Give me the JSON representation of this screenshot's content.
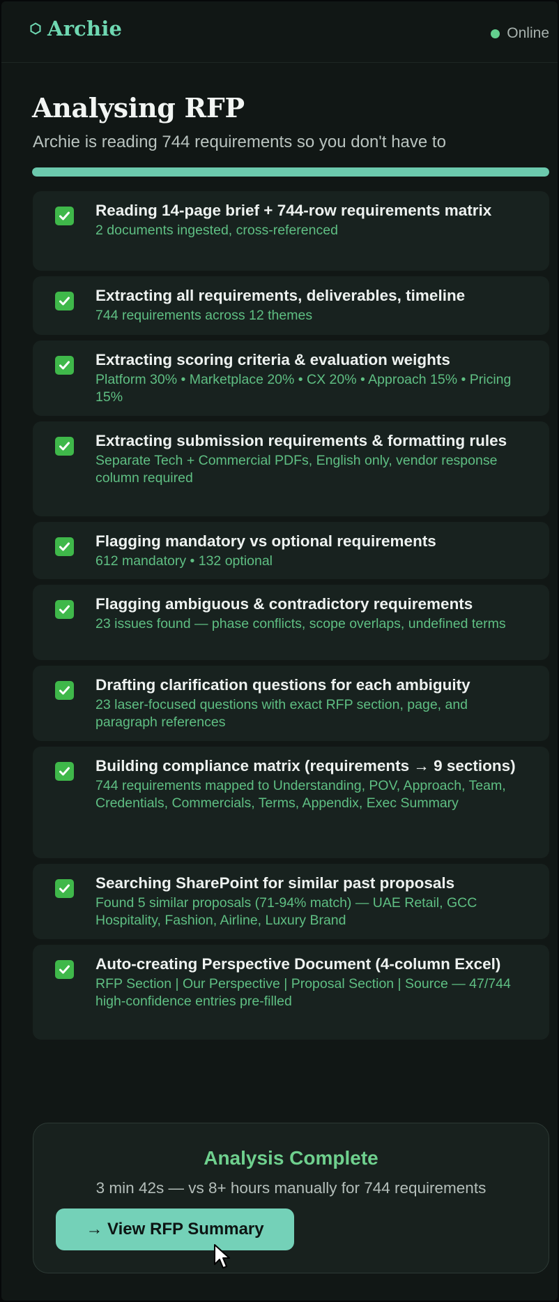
{
  "header": {
    "brand_name": "Archie",
    "brand_icon": "hexagon-icon",
    "status_text": "Online",
    "status_color": "#63d08e"
  },
  "main": {
    "title": "Analysing RFP",
    "subtitle": "Archie is reading 744 requirements so you don't have to",
    "progress_percent": 100,
    "steps": [
      {
        "title": "Reading 14-page brief + 744-row requirements matrix",
        "detail": "2 documents ingested, cross-referenced",
        "done": true
      },
      {
        "title": "Extracting all requirements, deliverables, timeline",
        "detail": "744 requirements across 12 themes",
        "done": true
      },
      {
        "title": "Extracting scoring criteria & evaluation weights",
        "detail": "Platform 30% • Marketplace 20% • CX 20% • Approach 15% • Pricing 15%",
        "done": true
      },
      {
        "title": "Extracting submission requirements & formatting rules",
        "detail": "Separate Tech + Commercial PDFs, English only, vendor response column required",
        "done": true
      },
      {
        "title": "Flagging mandatory vs optional requirements",
        "detail": "612 mandatory • 132 optional",
        "done": true
      },
      {
        "title": "Flagging ambiguous & contradictory requirements",
        "detail": "23 issues found — phase conflicts, scope overlaps, undefined terms",
        "done": true
      },
      {
        "title": "Drafting clarification questions for each ambiguity",
        "detail": "23 laser-focused questions with exact RFP section, page, and paragraph references",
        "done": true
      },
      {
        "title": "Building compliance matrix (requirements → 9 sections)",
        "detail": "744 requirements mapped to Understanding, POV, Approach, Team, Credentials, Commercials, Terms, Appendix, Exec Summary",
        "done": true
      },
      {
        "title": "Searching SharePoint for similar past proposals",
        "detail": "Found 5 similar proposals (71-94% match) — UAE Retail, GCC Hospitality, Fashion, Airline, Luxury Brand",
        "done": true
      },
      {
        "title": "Auto-creating Perspective Document (4-column Excel)",
        "detail": "RFP Section | Our Perspective | Proposal Section | Source — 47/744 high-confidence entries pre-filled",
        "done": true
      }
    ]
  },
  "completion": {
    "title": "Analysis Complete",
    "subtitle": "3 min 42s — vs 8+ hours manually for 744 requirements",
    "button_label": "→ View RFP Summary"
  },
  "colors": {
    "accent": "#6fd8b2",
    "check": "#3fb84a",
    "detail_text": "#5fbf83",
    "background": "#111715"
  }
}
